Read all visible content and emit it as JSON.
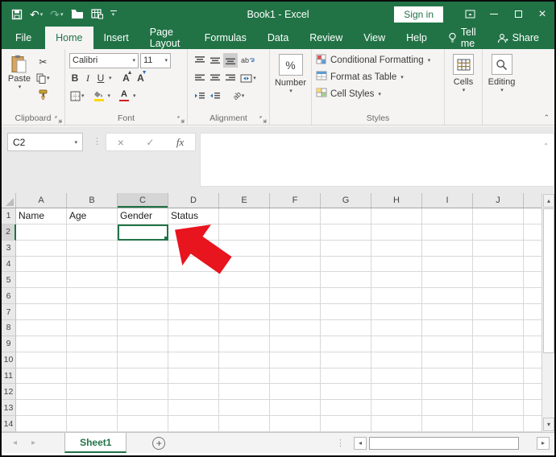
{
  "window": {
    "title": "Book1 - Excel",
    "sign_in": "Sign in"
  },
  "tabs": [
    {
      "label": "File"
    },
    {
      "label": "Home"
    },
    {
      "label": "Insert"
    },
    {
      "label": "Page Layout"
    },
    {
      "label": "Formulas"
    },
    {
      "label": "Data"
    },
    {
      "label": "Review"
    },
    {
      "label": "View"
    },
    {
      "label": "Help"
    }
  ],
  "tell_me": {
    "label": "Tell me"
  },
  "share": {
    "label": "Share"
  },
  "ribbon": {
    "clipboard": {
      "caption": "Clipboard",
      "paste_label": "Paste"
    },
    "font": {
      "caption": "Font",
      "font_name": "Calibri",
      "font_size": "11",
      "bold": "B",
      "italic": "I",
      "underline": "U",
      "grow": "A",
      "shrink": "A",
      "color_letter": "A"
    },
    "alignment": {
      "caption": "Alignment",
      "wrap_text": "ab",
      "orientation": "ab"
    },
    "number": {
      "caption": "Number",
      "percent": "%"
    },
    "styles": {
      "caption": "Styles",
      "conditional_formatting": "Conditional Formatting",
      "format_as_table": "Format as Table",
      "cell_styles": "Cell Styles"
    },
    "cells": {
      "label": "Cells"
    },
    "editing": {
      "label": "Editing"
    }
  },
  "formula_bar": {
    "name_box": "C2",
    "cancel": "×",
    "enter": "✓",
    "fx": "fx"
  },
  "sheet": {
    "columns": [
      "A",
      "B",
      "C",
      "D",
      "E",
      "F",
      "G",
      "H",
      "I",
      "J"
    ],
    "rows": [
      "1",
      "2",
      "3",
      "4",
      "5",
      "6",
      "7",
      "8",
      "9",
      "10",
      "11",
      "12",
      "13",
      "14"
    ],
    "cells": {
      "A1": "Name",
      "B1": "Age",
      "C1": "Gender",
      "D1": "Status"
    },
    "selected_cell": "C2",
    "selected_column": "C",
    "selected_row": "2"
  },
  "sheet_tabs": {
    "active": "Sheet1",
    "add": "+"
  },
  "icons": {
    "undo": "↶",
    "redo": "↷",
    "dropdown": "▾",
    "dots": "⋮",
    "nav_left": "◂",
    "nav_right": "▸",
    "scroll_up": "▴",
    "scroll_down": "▾",
    "collapse_formula": "▴",
    "collapse_ribbon": "▴",
    "cut": "✂",
    "close": "×",
    "minimize": "−"
  },
  "colors": {
    "excel_green": "#217346",
    "selection_green": "#217346",
    "sheet_underline_green": "#1e7145",
    "arrow_red": "#e8141e"
  }
}
